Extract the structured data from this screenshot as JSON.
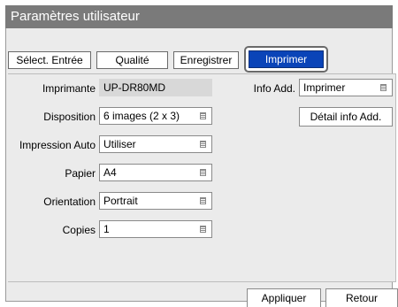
{
  "window": {
    "title": "Paramètres utilisateur"
  },
  "tabs": [
    {
      "label": "Sélect. Entrée"
    },
    {
      "label": "Qualité"
    },
    {
      "label": "Enregistrer"
    },
    {
      "label": "Imprimer"
    }
  ],
  "form": {
    "printer": {
      "label": "Imprimante",
      "value": "UP-DR80MD"
    },
    "layout": {
      "label": "Disposition",
      "value": "6 images (2 x 3)"
    },
    "auto_print": {
      "label": "Impression Auto",
      "value": "Utiliser"
    },
    "paper": {
      "label": "Papier",
      "value": "A4"
    },
    "orientation": {
      "label": "Orientation",
      "value": "Portrait"
    },
    "copies": {
      "label": "Copies",
      "value": "1"
    },
    "info_add": {
      "label": "Info Add.",
      "value": "Imprimer"
    },
    "info_detail_button": "Détail info Add."
  },
  "footer": {
    "apply": "Appliquer",
    "back": "Retour"
  },
  "colors": {
    "titlebar": "#7a7a7a",
    "active_tab": "#0a44b8",
    "panel": "#ebebeb"
  }
}
